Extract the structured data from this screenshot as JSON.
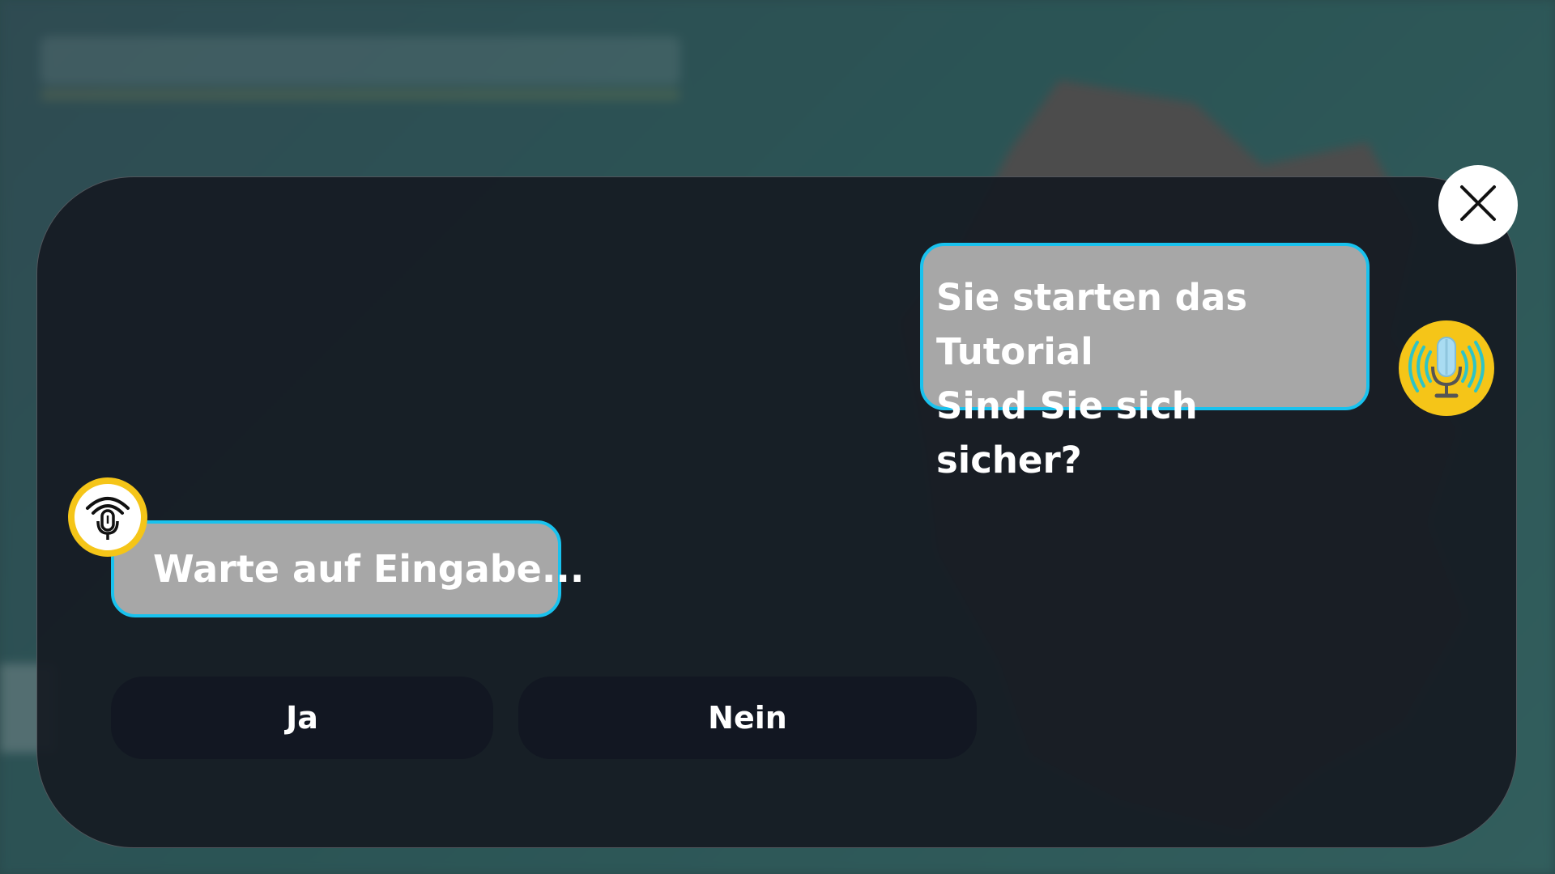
{
  "dialog": {
    "assistant_message": {
      "line1": "Sie starten das Tutorial",
      "line2": "Sind Sie sich sicher?"
    },
    "user_message": "Warte auf Eingabe...",
    "buttons": {
      "yes_label": "Ja",
      "no_label": "Nein"
    },
    "icons": {
      "close": "close-icon",
      "assistant_avatar": "microphone-broadcast-icon",
      "user_avatar": "microphone-listening-icon"
    }
  },
  "colors": {
    "bubble_fill": "#a7a7a7",
    "bubble_border": "#19c2ee",
    "avatar_yellow": "#f5c518",
    "panel": "#161b22",
    "button_fill": "#121722"
  }
}
